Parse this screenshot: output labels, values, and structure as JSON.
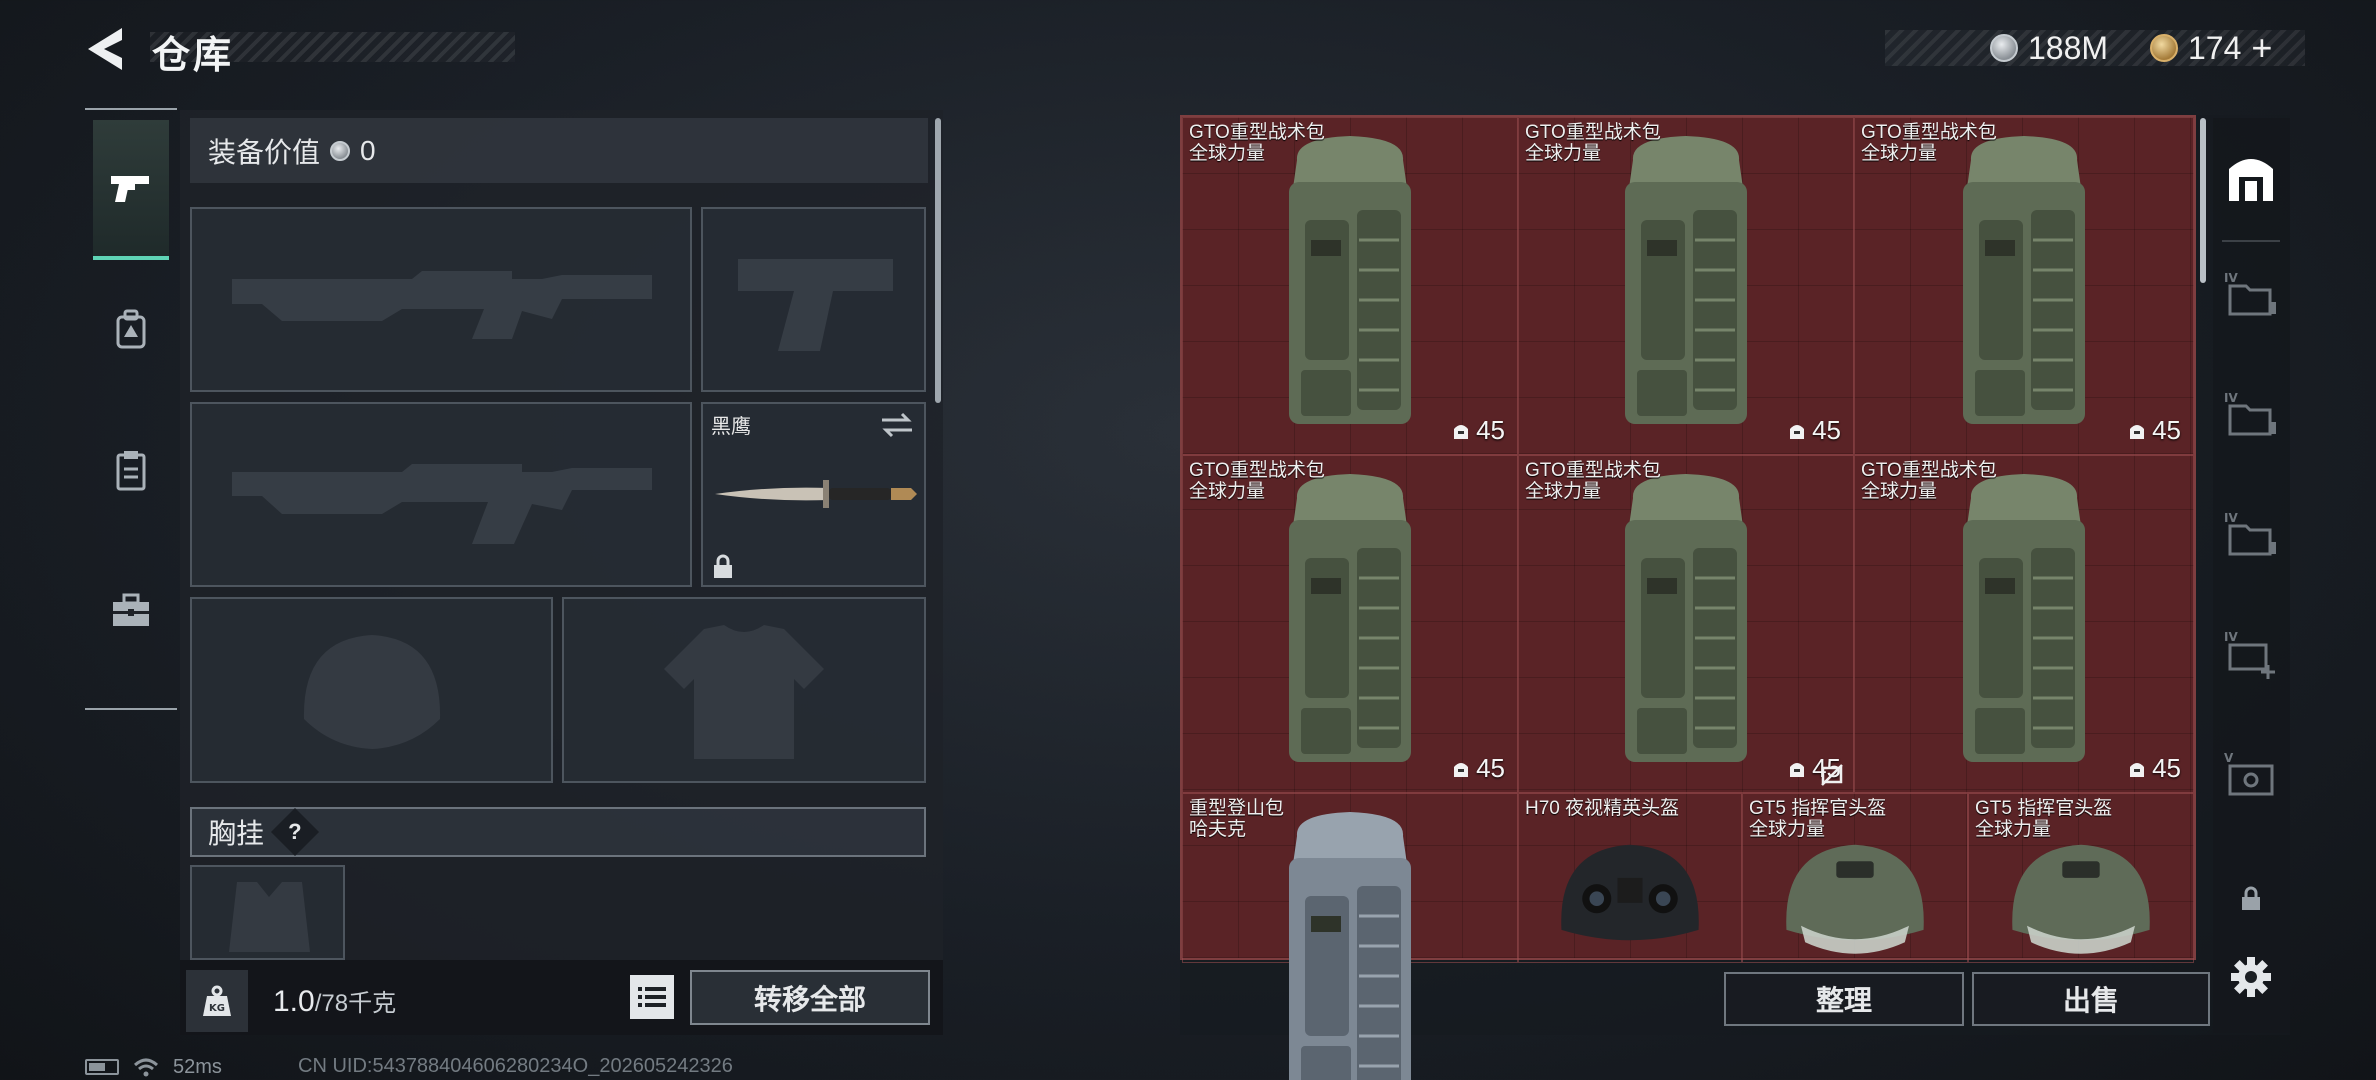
{
  "header": {
    "title": "仓库",
    "back_icon": "back-arrow-icon"
  },
  "currency": {
    "silver_amount": "188M",
    "gold_amount": "174",
    "gold_add_label": "+",
    "silver_icon": "silver-coin-icon",
    "gold_icon": "gold-coin-icon"
  },
  "left_tabs": [
    {
      "icon": "pistol-icon",
      "active": true
    },
    {
      "icon": "backpack-icon",
      "active": false
    },
    {
      "icon": "clipboard-icon",
      "active": false
    },
    {
      "icon": "toolbox-icon",
      "active": false
    }
  ],
  "equipment": {
    "value_label": "装备价值",
    "value_amount": "0",
    "slots": [
      {
        "slot": "primary-weapon-1",
        "item": "rifle-silhouette",
        "filled": false
      },
      {
        "slot": "sidearm",
        "item": "pistol-silhouette",
        "filled": false
      },
      {
        "slot": "primary-weapon-2",
        "item": "rifle-silhouette",
        "filled": false
      },
      {
        "slot": "melee",
        "item_name": "黑鹰",
        "filled": true,
        "locked": true
      },
      {
        "slot": "helmet",
        "item": "helmet-silhouette",
        "filled": false
      },
      {
        "slot": "body-armor",
        "item": "armor-silhouette",
        "filled": false
      }
    ],
    "chest_rig_label": "胸挂",
    "chest_rig_help": "?",
    "weight_current": "1.0",
    "weight_capacity": "/78千克",
    "transfer_all_label": "转移全部"
  },
  "storage": {
    "items": [
      {
        "name": "GTO重型战术包\n全球力量",
        "qty": "45",
        "type": "backpack"
      },
      {
        "name": "GTO重型战术包\n全球力量",
        "qty": "45",
        "type": "backpack"
      },
      {
        "name": "GTO重型战术包\n全球力量",
        "qty": "45",
        "type": "backpack"
      },
      {
        "name": "GTO重型战术包\n全球力量",
        "qty": "45",
        "type": "backpack"
      },
      {
        "name": "GTO重型战术包\n全球力量",
        "qty": "45",
        "type": "backpack",
        "untradeable": true
      },
      {
        "name": "GTO重型战术包\n全球力量",
        "qty": "45",
        "type": "backpack"
      },
      {
        "name": "重型登山包\n哈夫克",
        "qty": "",
        "type": "backpack-grey"
      },
      {
        "name": "H70 夜视精英头盔",
        "qty": "",
        "type": "nv-helmet"
      },
      {
        "name": "GT5 指挥官头盔\n全球力量",
        "qty": "",
        "type": "helmet"
      },
      {
        "name": "GT5 指挥官头盔\n全球力量",
        "qty": "",
        "type": "helmet"
      }
    ],
    "sort_label": "整理",
    "sell_label": "出售"
  },
  "right_tabs": [
    {
      "icon": "storage-main-icon",
      "active": true
    },
    {
      "icon": "folder-iv-icon"
    },
    {
      "icon": "folder-iv-icon"
    },
    {
      "icon": "folder-iv-icon"
    },
    {
      "icon": "add-storage-iv-icon"
    },
    {
      "icon": "storage-v-icon"
    },
    {
      "icon": "lock-icon"
    },
    {
      "icon": "settings-gear-icon"
    }
  ],
  "status": {
    "ping": "52ms",
    "uid_text": "CN UID:543788404606280234O_202605242326"
  },
  "colors": {
    "accent_teal": "#5fd4b5",
    "storage_red": "#5a2326",
    "panel_dark": "#1e2228"
  }
}
